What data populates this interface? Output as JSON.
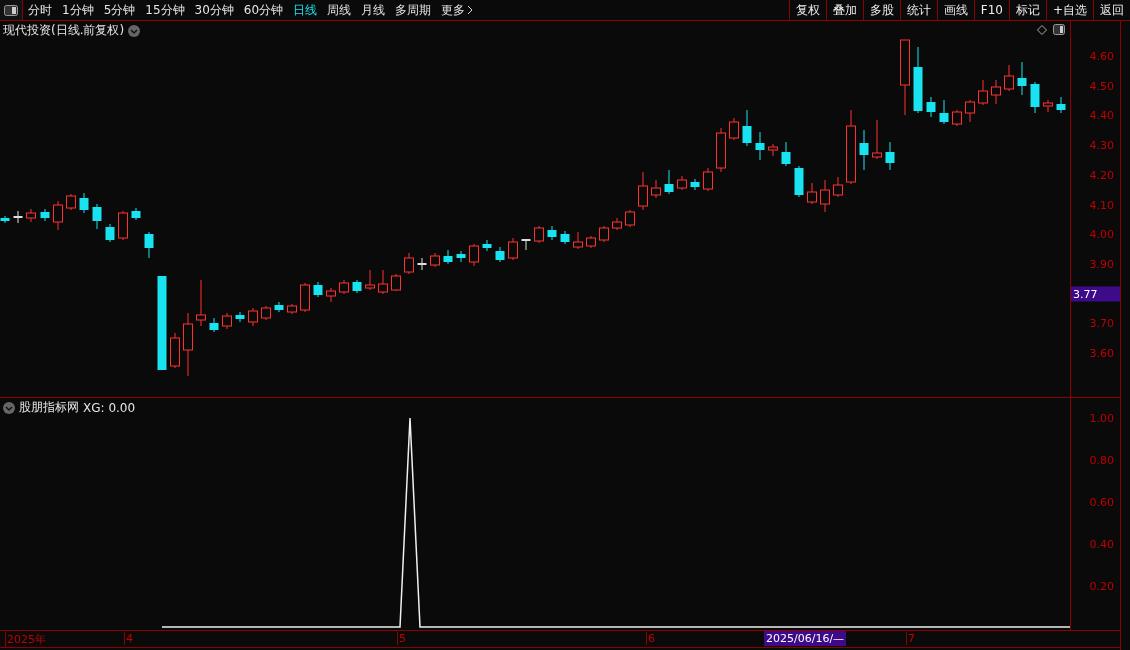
{
  "toolbar": {
    "periods": [
      {
        "label": "分时",
        "selected": false
      },
      {
        "label": "1分钟",
        "selected": false
      },
      {
        "label": "5分钟",
        "selected": false
      },
      {
        "label": "15分钟",
        "selected": false
      },
      {
        "label": "30分钟",
        "selected": false
      },
      {
        "label": "60分钟",
        "selected": false
      },
      {
        "label": "日线",
        "selected": true
      },
      {
        "label": "周线",
        "selected": false
      },
      {
        "label": "月线",
        "selected": false
      },
      {
        "label": "多周期",
        "selected": false
      }
    ],
    "more": "更多",
    "actions": [
      "复权",
      "叠加",
      "多股",
      "统计",
      "画线",
      "F10",
      "标记",
      "+自选",
      "返回"
    ]
  },
  "main_chart": {
    "title": "现代投资(日线.前复权)",
    "price_axis": [
      "4.60",
      "4.50",
      "4.40",
      "4.30",
      "4.20",
      "4.10",
      "4.00",
      "3.90",
      "3.70",
      "3.60"
    ],
    "current_price": "3.77"
  },
  "indicator": {
    "name": "股朋指标网",
    "value": "XG: 0.00",
    "axis": [
      "1.00",
      "0.80",
      "0.60",
      "0.40",
      "0.20"
    ]
  },
  "date_axis": [
    "2025年",
    "4",
    "5",
    "6",
    "7"
  ],
  "cursor_date": "2025/06/16/—"
}
